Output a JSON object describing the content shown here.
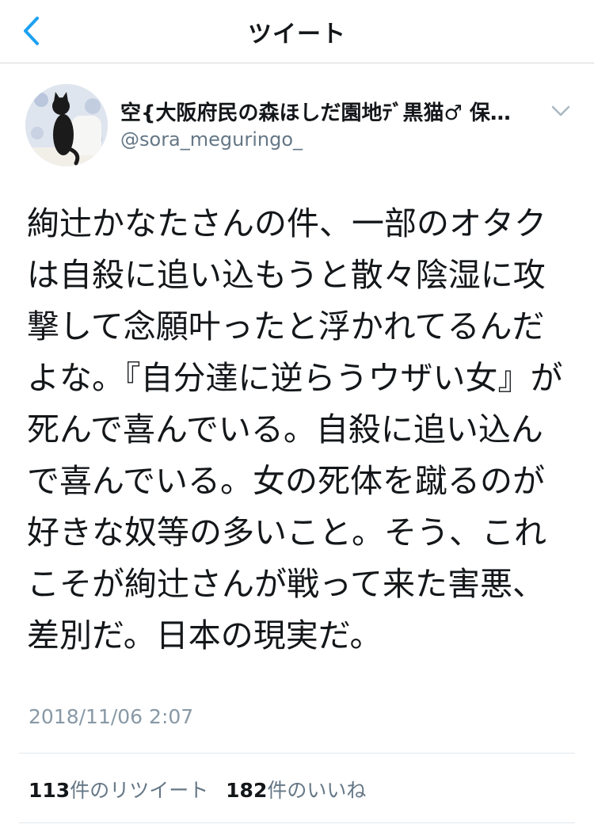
{
  "nav": {
    "title": "ツイート",
    "back_icon": "chevron-left-icon"
  },
  "colors": {
    "accent": "#1da1f2",
    "text": "#14171a",
    "secondary": "#657786",
    "timestamp": "#8899a6",
    "divider": "#e1e8ed"
  },
  "tweet": {
    "display_name": "空{大阪府民の森ほしだ園地ﾃﾞ黒猫♂ 保…",
    "username": "@sora_meguringo_",
    "text": "絢辻かなたさんの件、一部のオタクは自殺に追い込もうと散々陰湿に攻撃して念願叶ったと浮かれてるんだよな。『自分達に逆らうウザい女』が死んで喜んでいる。自殺に追い込んで喜んでいる。女の死体を蹴るのが好きな奴等の多いこと。そう、これこそが絢辻さんが戦って来た害悪、差別だ。日本の現実だ。",
    "timestamp": "2018/11/06 2:07",
    "retweets": {
      "count": "113",
      "label": "件のリツイート"
    },
    "likes": {
      "count": "182",
      "label": "件のいいね"
    }
  }
}
